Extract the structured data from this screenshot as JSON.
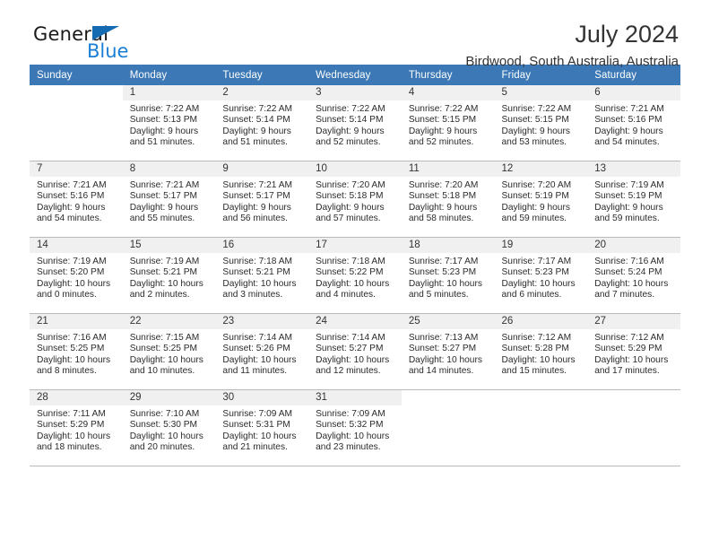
{
  "brand": {
    "name_part1": "General",
    "name_part2": "Blue",
    "triangle_icon": "triangle-icon",
    "color_dark": "#1a1a1a",
    "color_blue": "#1b7ed6"
  },
  "header": {
    "title": "July 2024",
    "subtitle": "Birdwood, South Australia, Australia"
  },
  "theme": {
    "header_row_bg": "#3b78b5",
    "header_row_text": "#ffffff",
    "daynum_band_bg": "#f0f0f0",
    "row_border": "#b9b9b9",
    "body_text": "#2b2b2b"
  },
  "weekdays": [
    "Sunday",
    "Monday",
    "Tuesday",
    "Wednesday",
    "Thursday",
    "Friday",
    "Saturday"
  ],
  "weeks": [
    [
      {
        "day": "",
        "sunrise": "",
        "sunset": "",
        "daylight_line1": "",
        "daylight_line2": "",
        "blank": true
      },
      {
        "day": "1",
        "sunrise": "Sunrise: 7:22 AM",
        "sunset": "Sunset: 5:13 PM",
        "daylight_line1": "Daylight: 9 hours",
        "daylight_line2": "and 51 minutes."
      },
      {
        "day": "2",
        "sunrise": "Sunrise: 7:22 AM",
        "sunset": "Sunset: 5:14 PM",
        "daylight_line1": "Daylight: 9 hours",
        "daylight_line2": "and 51 minutes."
      },
      {
        "day": "3",
        "sunrise": "Sunrise: 7:22 AM",
        "sunset": "Sunset: 5:14 PM",
        "daylight_line1": "Daylight: 9 hours",
        "daylight_line2": "and 52 minutes."
      },
      {
        "day": "4",
        "sunrise": "Sunrise: 7:22 AM",
        "sunset": "Sunset: 5:15 PM",
        "daylight_line1": "Daylight: 9 hours",
        "daylight_line2": "and 52 minutes."
      },
      {
        "day": "5",
        "sunrise": "Sunrise: 7:22 AM",
        "sunset": "Sunset: 5:15 PM",
        "daylight_line1": "Daylight: 9 hours",
        "daylight_line2": "and 53 minutes."
      },
      {
        "day": "6",
        "sunrise": "Sunrise: 7:21 AM",
        "sunset": "Sunset: 5:16 PM",
        "daylight_line1": "Daylight: 9 hours",
        "daylight_line2": "and 54 minutes."
      }
    ],
    [
      {
        "day": "7",
        "sunrise": "Sunrise: 7:21 AM",
        "sunset": "Sunset: 5:16 PM",
        "daylight_line1": "Daylight: 9 hours",
        "daylight_line2": "and 54 minutes."
      },
      {
        "day": "8",
        "sunrise": "Sunrise: 7:21 AM",
        "sunset": "Sunset: 5:17 PM",
        "daylight_line1": "Daylight: 9 hours",
        "daylight_line2": "and 55 minutes."
      },
      {
        "day": "9",
        "sunrise": "Sunrise: 7:21 AM",
        "sunset": "Sunset: 5:17 PM",
        "daylight_line1": "Daylight: 9 hours",
        "daylight_line2": "and 56 minutes."
      },
      {
        "day": "10",
        "sunrise": "Sunrise: 7:20 AM",
        "sunset": "Sunset: 5:18 PM",
        "daylight_line1": "Daylight: 9 hours",
        "daylight_line2": "and 57 minutes."
      },
      {
        "day": "11",
        "sunrise": "Sunrise: 7:20 AM",
        "sunset": "Sunset: 5:18 PM",
        "daylight_line1": "Daylight: 9 hours",
        "daylight_line2": "and 58 minutes."
      },
      {
        "day": "12",
        "sunrise": "Sunrise: 7:20 AM",
        "sunset": "Sunset: 5:19 PM",
        "daylight_line1": "Daylight: 9 hours",
        "daylight_line2": "and 59 minutes."
      },
      {
        "day": "13",
        "sunrise": "Sunrise: 7:19 AM",
        "sunset": "Sunset: 5:19 PM",
        "daylight_line1": "Daylight: 9 hours",
        "daylight_line2": "and 59 minutes."
      }
    ],
    [
      {
        "day": "14",
        "sunrise": "Sunrise: 7:19 AM",
        "sunset": "Sunset: 5:20 PM",
        "daylight_line1": "Daylight: 10 hours",
        "daylight_line2": "and 0 minutes."
      },
      {
        "day": "15",
        "sunrise": "Sunrise: 7:19 AM",
        "sunset": "Sunset: 5:21 PM",
        "daylight_line1": "Daylight: 10 hours",
        "daylight_line2": "and 2 minutes."
      },
      {
        "day": "16",
        "sunrise": "Sunrise: 7:18 AM",
        "sunset": "Sunset: 5:21 PM",
        "daylight_line1": "Daylight: 10 hours",
        "daylight_line2": "and 3 minutes."
      },
      {
        "day": "17",
        "sunrise": "Sunrise: 7:18 AM",
        "sunset": "Sunset: 5:22 PM",
        "daylight_line1": "Daylight: 10 hours",
        "daylight_line2": "and 4 minutes."
      },
      {
        "day": "18",
        "sunrise": "Sunrise: 7:17 AM",
        "sunset": "Sunset: 5:23 PM",
        "daylight_line1": "Daylight: 10 hours",
        "daylight_line2": "and 5 minutes."
      },
      {
        "day": "19",
        "sunrise": "Sunrise: 7:17 AM",
        "sunset": "Sunset: 5:23 PM",
        "daylight_line1": "Daylight: 10 hours",
        "daylight_line2": "and 6 minutes."
      },
      {
        "day": "20",
        "sunrise": "Sunrise: 7:16 AM",
        "sunset": "Sunset: 5:24 PM",
        "daylight_line1": "Daylight: 10 hours",
        "daylight_line2": "and 7 minutes."
      }
    ],
    [
      {
        "day": "21",
        "sunrise": "Sunrise: 7:16 AM",
        "sunset": "Sunset: 5:25 PM",
        "daylight_line1": "Daylight: 10 hours",
        "daylight_line2": "and 8 minutes."
      },
      {
        "day": "22",
        "sunrise": "Sunrise: 7:15 AM",
        "sunset": "Sunset: 5:25 PM",
        "daylight_line1": "Daylight: 10 hours",
        "daylight_line2": "and 10 minutes."
      },
      {
        "day": "23",
        "sunrise": "Sunrise: 7:14 AM",
        "sunset": "Sunset: 5:26 PM",
        "daylight_line1": "Daylight: 10 hours",
        "daylight_line2": "and 11 minutes."
      },
      {
        "day": "24",
        "sunrise": "Sunrise: 7:14 AM",
        "sunset": "Sunset: 5:27 PM",
        "daylight_line1": "Daylight: 10 hours",
        "daylight_line2": "and 12 minutes."
      },
      {
        "day": "25",
        "sunrise": "Sunrise: 7:13 AM",
        "sunset": "Sunset: 5:27 PM",
        "daylight_line1": "Daylight: 10 hours",
        "daylight_line2": "and 14 minutes."
      },
      {
        "day": "26",
        "sunrise": "Sunrise: 7:12 AM",
        "sunset": "Sunset: 5:28 PM",
        "daylight_line1": "Daylight: 10 hours",
        "daylight_line2": "and 15 minutes."
      },
      {
        "day": "27",
        "sunrise": "Sunrise: 7:12 AM",
        "sunset": "Sunset: 5:29 PM",
        "daylight_line1": "Daylight: 10 hours",
        "daylight_line2": "and 17 minutes."
      }
    ],
    [
      {
        "day": "28",
        "sunrise": "Sunrise: 7:11 AM",
        "sunset": "Sunset: 5:29 PM",
        "daylight_line1": "Daylight: 10 hours",
        "daylight_line2": "and 18 minutes."
      },
      {
        "day": "29",
        "sunrise": "Sunrise: 7:10 AM",
        "sunset": "Sunset: 5:30 PM",
        "daylight_line1": "Daylight: 10 hours",
        "daylight_line2": "and 20 minutes."
      },
      {
        "day": "30",
        "sunrise": "Sunrise: 7:09 AM",
        "sunset": "Sunset: 5:31 PM",
        "daylight_line1": "Daylight: 10 hours",
        "daylight_line2": "and 21 minutes."
      },
      {
        "day": "31",
        "sunrise": "Sunrise: 7:09 AM",
        "sunset": "Sunset: 5:32 PM",
        "daylight_line1": "Daylight: 10 hours",
        "daylight_line2": "and 23 minutes."
      },
      {
        "day": "",
        "sunrise": "",
        "sunset": "",
        "daylight_line1": "",
        "daylight_line2": "",
        "blank": true
      },
      {
        "day": "",
        "sunrise": "",
        "sunset": "",
        "daylight_line1": "",
        "daylight_line2": "",
        "blank": true
      },
      {
        "day": "",
        "sunrise": "",
        "sunset": "",
        "daylight_line1": "",
        "daylight_line2": "",
        "blank": true
      }
    ]
  ]
}
